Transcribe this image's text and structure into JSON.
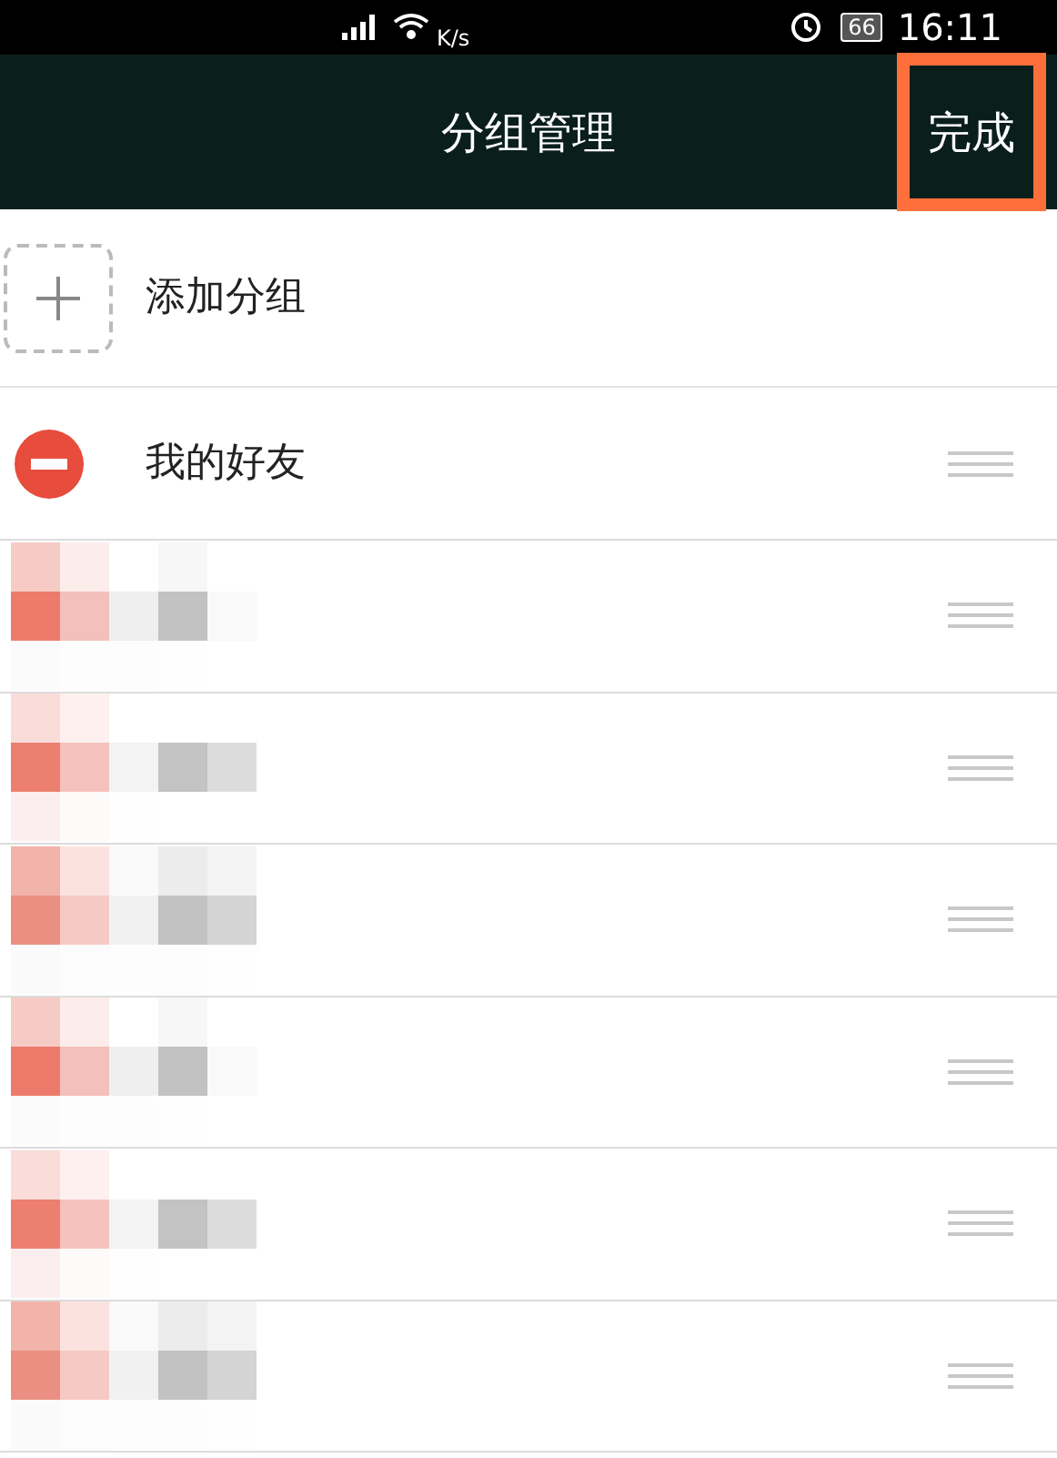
{
  "status_bar": {
    "net_speed_unit": "K/s",
    "battery": "66",
    "time": "16:11"
  },
  "header": {
    "title": "分组管理",
    "done_button": {
      "label": "完成",
      "highlighted": true
    }
  },
  "add_group": {
    "label": "添加分组"
  },
  "groups": [
    {
      "kind": "group",
      "name": "我的好友"
    },
    {
      "kind": "redacted"
    },
    {
      "kind": "redacted"
    },
    {
      "kind": "redacted"
    },
    {
      "kind": "redacted"
    },
    {
      "kind": "redacted"
    },
    {
      "kind": "redacted"
    }
  ]
}
